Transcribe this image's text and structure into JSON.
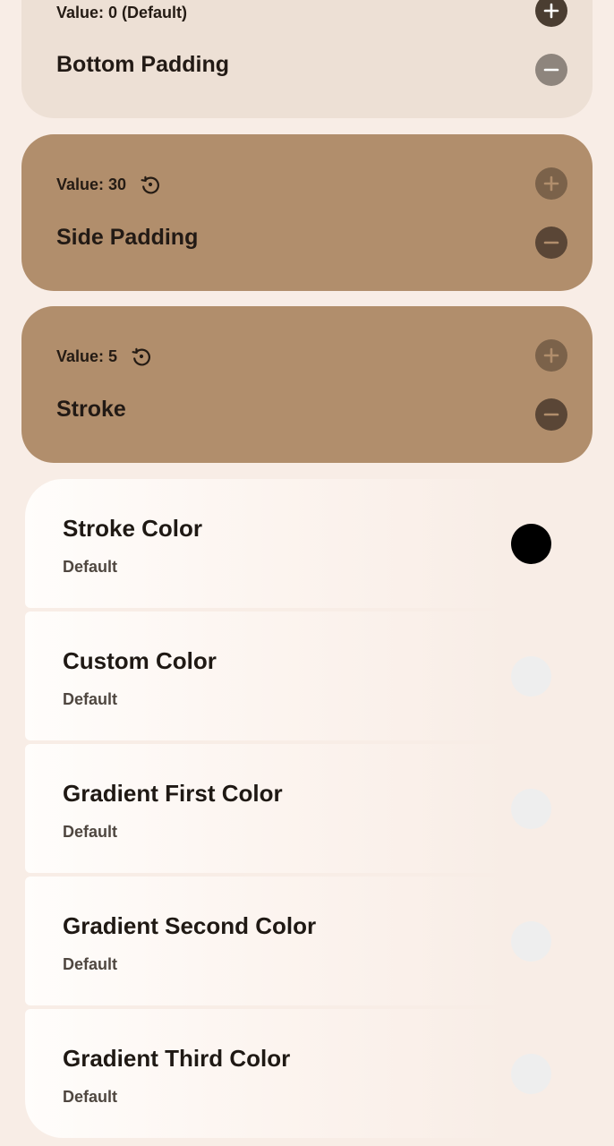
{
  "bottom_padding": {
    "value_label": "Value: 0 (Default)",
    "title": "Bottom Padding",
    "plus_icon": "plus-icon",
    "minus_icon": "minus-icon"
  },
  "side_padding": {
    "value_label": "Value: 30",
    "title": "Side Padding",
    "reset_icon": "reset-icon"
  },
  "stroke": {
    "value_label": "Value: 5",
    "title": "Stroke",
    "reset_icon": "reset-icon"
  },
  "color_items": [
    {
      "title": "Stroke Color",
      "subtitle": "Default",
      "swatch_color": "#000000"
    },
    {
      "title": "Custom Color",
      "subtitle": "Default",
      "swatch_color": "#eeeeee"
    },
    {
      "title": "Gradient First Color",
      "subtitle": "Default",
      "swatch_color": "#eeeeee"
    },
    {
      "title": "Gradient Second Color",
      "subtitle": "Default",
      "swatch_color": "#eeeeee"
    },
    {
      "title": "Gradient Third Color",
      "subtitle": "Default",
      "swatch_color": "#eeeeee"
    }
  ],
  "colors": {
    "background": "#f8ede6",
    "active_card": "#b18e6c",
    "inactive_card": "#ede0d5"
  }
}
